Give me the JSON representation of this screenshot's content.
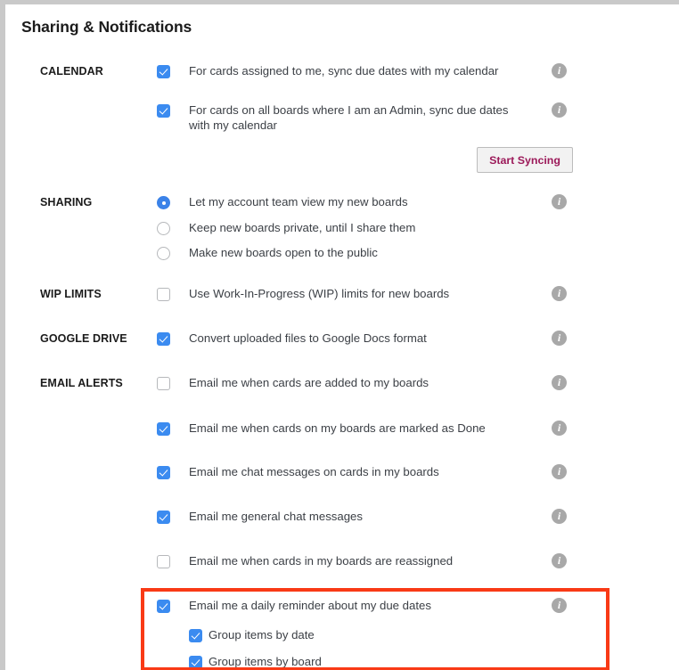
{
  "panel": {
    "title": "Sharing & Notifications"
  },
  "colors": {
    "accent_checkbox": "#3b8bf0",
    "accent_radio": "#3b82e8",
    "info_icon": "#a8a8a8",
    "button_text": "#9c1a5a",
    "highlight_border": "#f93a16",
    "body_text": "#3b3f45",
    "frame": "#c9c9c9"
  },
  "sections": [
    {
      "label": "CALENDAR",
      "rows": [
        {
          "control": "checkbox",
          "state": "checked",
          "text": "For cards assigned to me, sync due dates with my calendar",
          "info": true,
          "indent": false
        },
        {
          "control": "checkbox",
          "state": "checked",
          "text": "For cards on all boards where I am an Admin, sync due dates with my calendar",
          "info": true,
          "indent": false
        }
      ]
    },
    {
      "label": "SHARING",
      "rows": [
        {
          "control": "radio",
          "state": "checked",
          "text": "Let my account team view my new boards",
          "info": true,
          "indent": false
        },
        {
          "control": "radio",
          "state": "unchecked",
          "text": "Keep new boards private, until I share them",
          "info": false,
          "indent": false
        },
        {
          "control": "radio",
          "state": "unchecked",
          "text": "Make new boards open to the public",
          "info": false,
          "indent": false
        }
      ]
    },
    {
      "label": "WIP LIMITS",
      "rows": [
        {
          "control": "checkbox",
          "state": "unchecked",
          "text": "Use Work-In-Progress (WIP) limits for new boards",
          "info": true,
          "indent": false
        }
      ]
    },
    {
      "label": "GOOGLE DRIVE",
      "rows": [
        {
          "control": "checkbox",
          "state": "checked",
          "text": "Convert uploaded files to Google Docs format",
          "info": true,
          "indent": false
        }
      ]
    },
    {
      "label": "EMAIL ALERTS",
      "rows": [
        {
          "control": "checkbox",
          "state": "unchecked",
          "text": "Email me when cards are added to my boards",
          "info": true,
          "indent": false
        },
        {
          "control": "checkbox",
          "state": "checked",
          "text": "Email me when cards on my boards are marked as Done",
          "info": true,
          "indent": false
        },
        {
          "control": "checkbox",
          "state": "checked",
          "text": "Email me chat messages on cards in my boards",
          "info": true,
          "indent": false
        },
        {
          "control": "checkbox",
          "state": "checked",
          "text": "Email me general chat messages",
          "info": true,
          "indent": false
        },
        {
          "control": "checkbox",
          "state": "unchecked",
          "text": "Email me when cards in my boards are reassigned",
          "info": true,
          "indent": false
        },
        {
          "control": "checkbox",
          "state": "checked",
          "text": "Email me a daily reminder about my due dates",
          "info": true,
          "indent": false
        },
        {
          "control": "checkbox",
          "state": "checked",
          "text": "Group items by date",
          "info": false,
          "indent": true
        },
        {
          "control": "checkbox",
          "state": "checked",
          "text": "Group items by board",
          "info": false,
          "indent": true
        }
      ]
    }
  ],
  "sync_button": {
    "label": "Start Syncing"
  },
  "icons": {
    "info": "info-icon",
    "check": "check-icon",
    "radio_dot": "radio-dot-icon"
  },
  "layout": {
    "row_tops": [
      66,
      110,
      213,
      242,
      270,
      316,
      366,
      416,
      467,
      516,
      566,
      616,
      666,
      699,
      729
    ],
    "section_label_tops": [
      66,
      213,
      316,
      366,
      416
    ]
  }
}
